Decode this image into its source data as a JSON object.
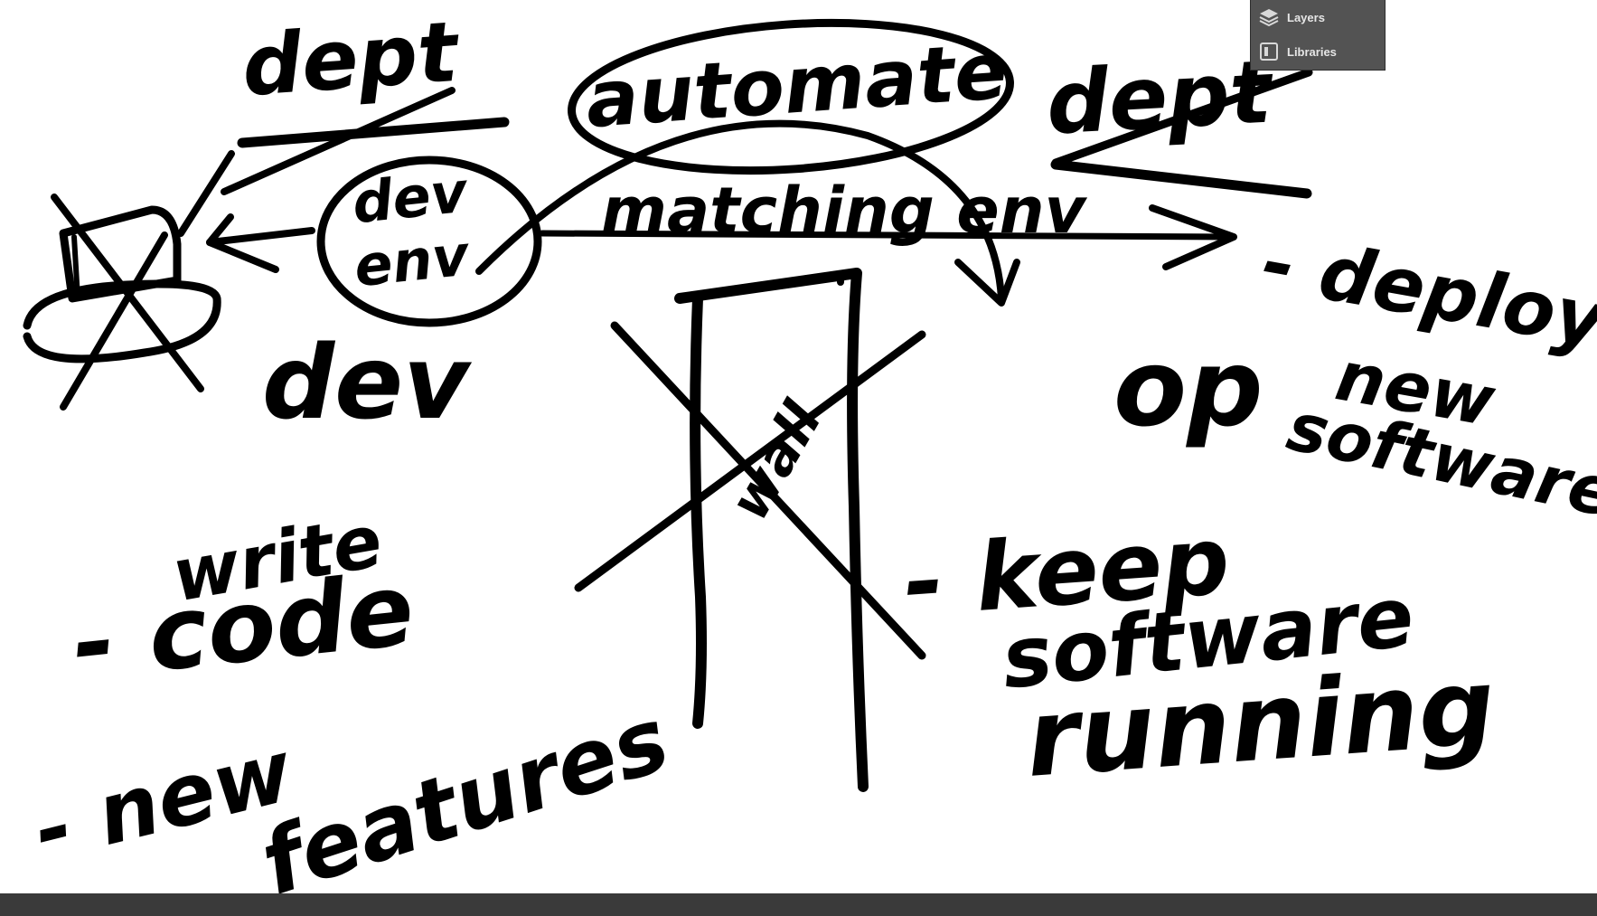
{
  "panel": {
    "items": [
      {
        "label": "Layers",
        "icon": "layers-icon"
      },
      {
        "label": "Libraries",
        "icon": "libraries-icon"
      }
    ]
  },
  "drawing": {
    "dept_left": "dept",
    "automate": "automate",
    "dept_right": "dept",
    "dev_env": [
      "dev",
      "env"
    ],
    "matching_env": "matching env",
    "dev": "dev",
    "op": "op",
    "deploy_lines": [
      "- deploy",
      "new",
      "software"
    ],
    "write": "write",
    "code_line": "- code",
    "new_features": [
      "- new",
      "features"
    ],
    "keep_lines": [
      "- keep",
      "software",
      "running"
    ],
    "wall_text": "wall"
  },
  "colors": {
    "ink": "#000000",
    "canvas": "#ffffff",
    "panel_bg": "#535353",
    "panel_text": "#e6e6e6"
  }
}
